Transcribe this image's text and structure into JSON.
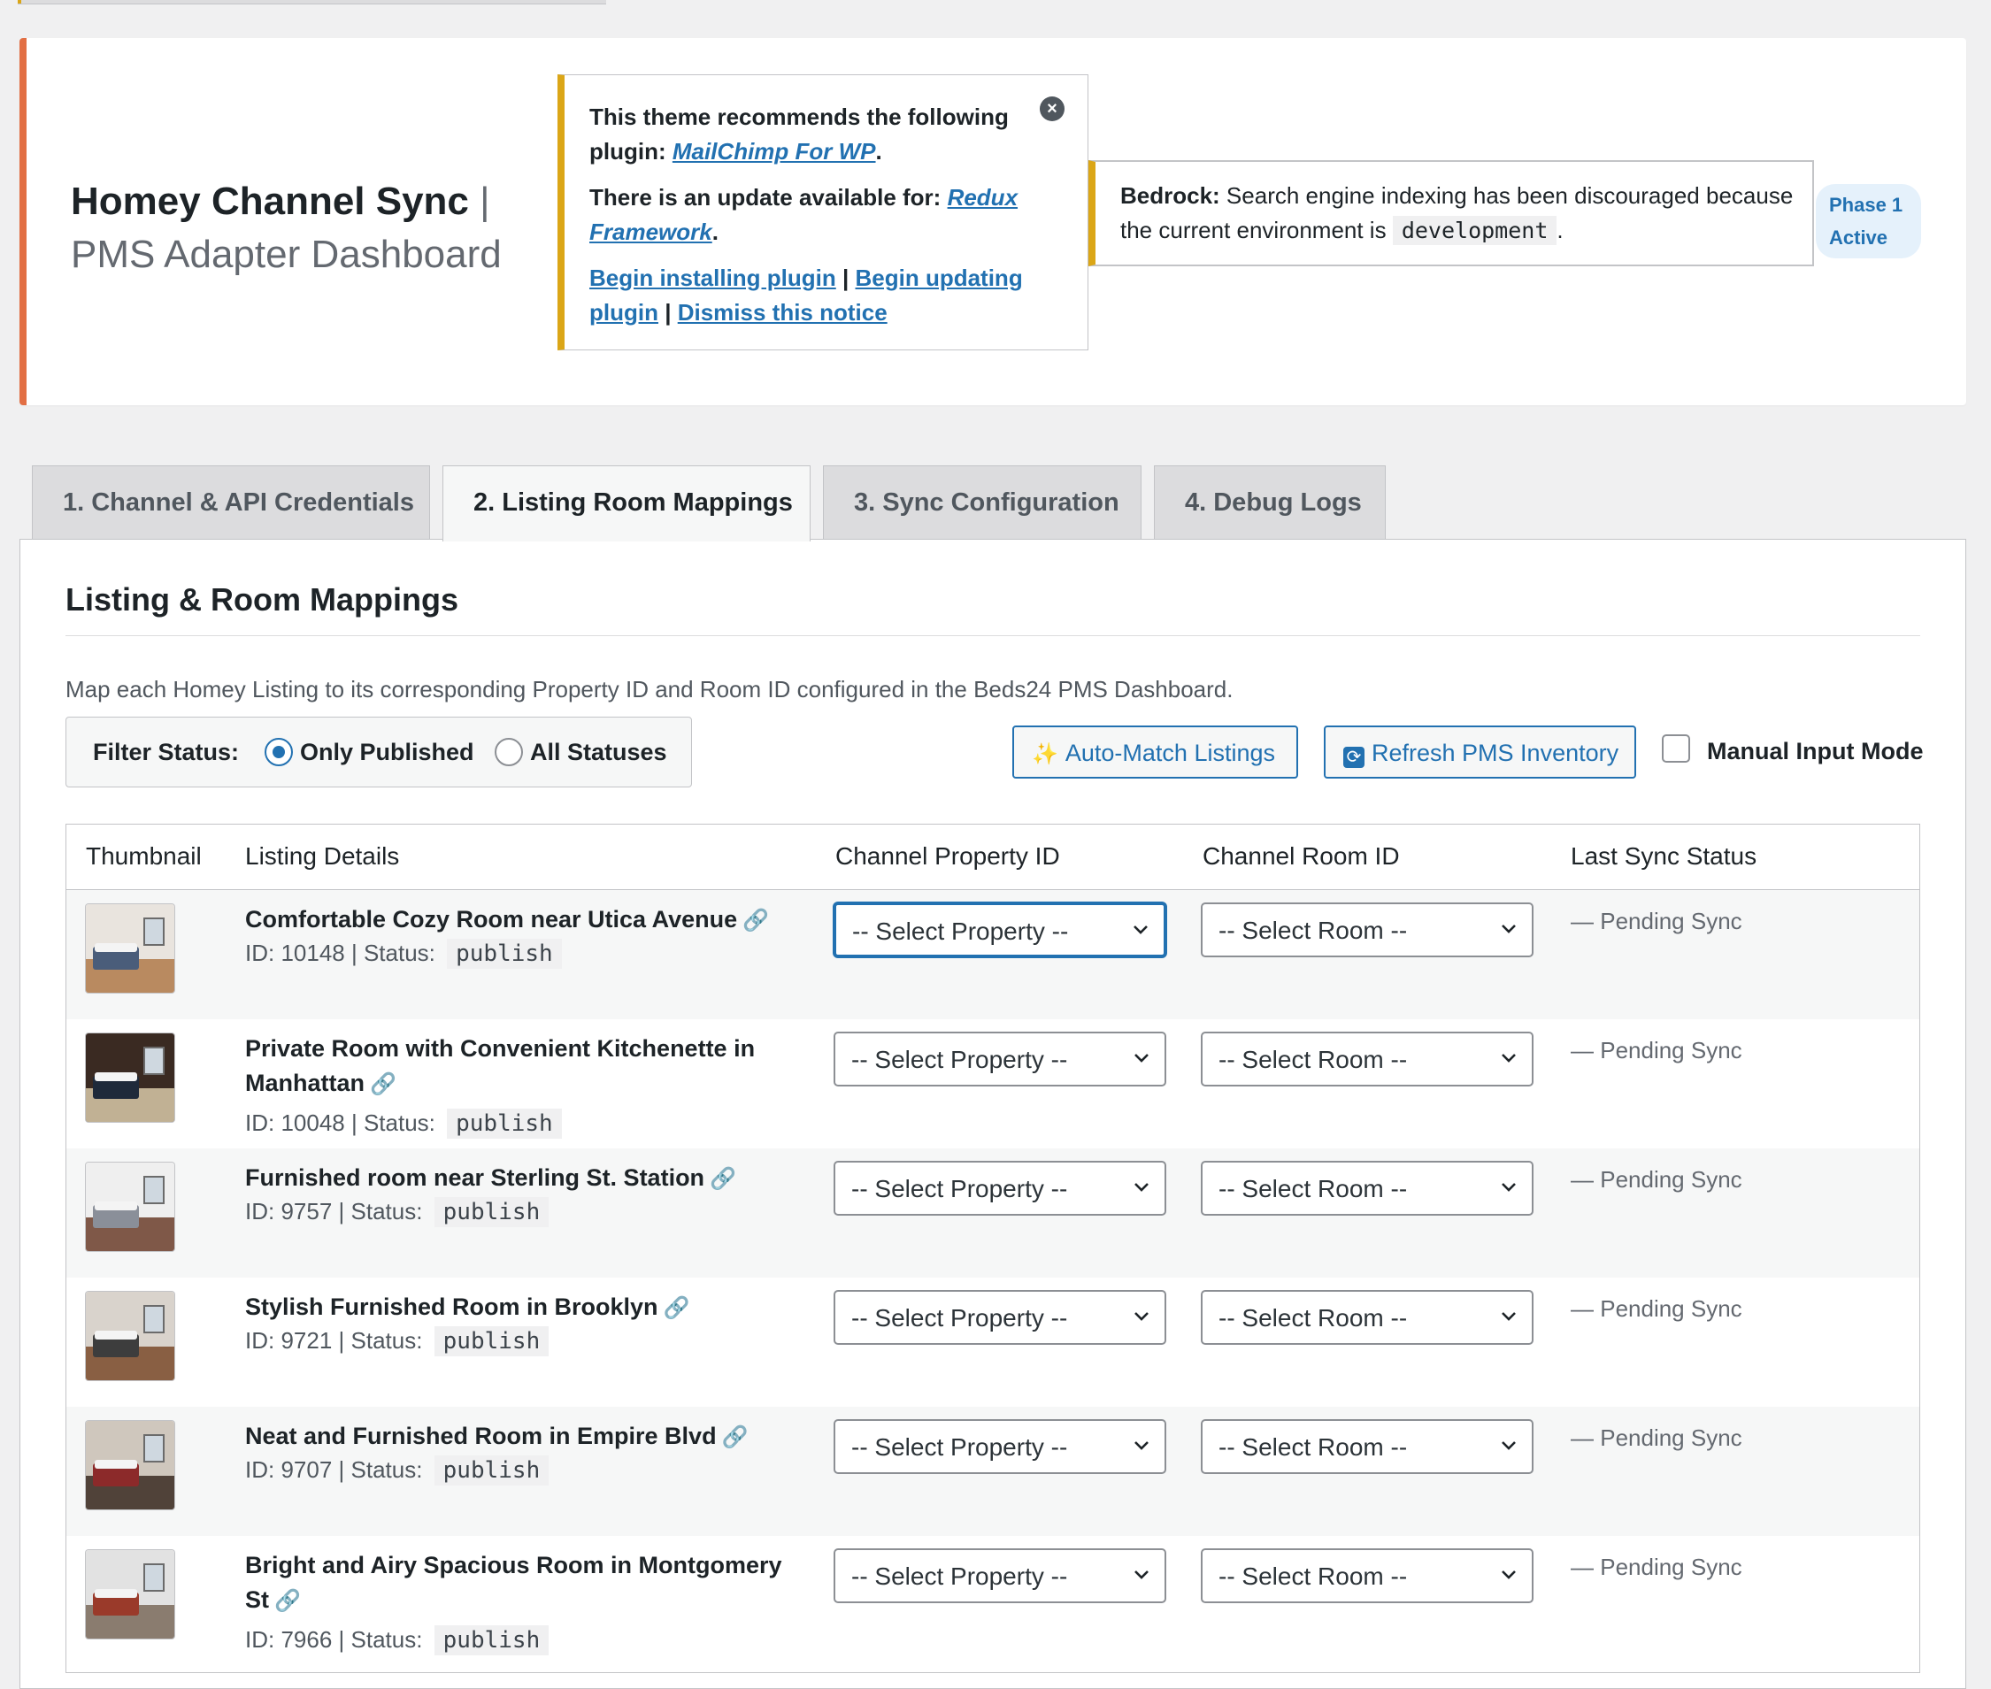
{
  "header": {
    "title": "Homey Channel Sync",
    "separator": "|",
    "subtitle": "PMS Adapter Dashboard",
    "phase_badge_line1": "Phase 1",
    "phase_badge_line2": "Active"
  },
  "plugin_notice": {
    "line1_prefix": "This theme recommends the following plugin: ",
    "line1_link": "MailChimp For WP",
    "line1_suffix": ".",
    "line2_prefix": "There is an update available for: ",
    "line2_link": "Redux Framework",
    "line2_suffix": ".",
    "action_install": "Begin installing plugin",
    "action_update": "Begin updating plugin",
    "action_dismiss": "Dismiss this notice",
    "divider": " | ",
    "close_icon": "×"
  },
  "bedrock_notice": {
    "label": "Bedrock:",
    "text": " Search engine indexing has been discouraged because the current environment is ",
    "env": "development",
    "suffix": "."
  },
  "tabs": [
    {
      "label": "1. Channel & API Credentials",
      "active": false
    },
    {
      "label": "2. Listing Room Mappings",
      "active": true
    },
    {
      "label": "3. Sync Configuration",
      "active": false
    },
    {
      "label": "4. Debug Logs",
      "active": false
    }
  ],
  "panel": {
    "title": "Listing & Room Mappings",
    "description": "Map each Homey Listing to its corresponding Property ID and Room ID configured in the Beds24 PMS Dashboard.",
    "filter_label": "Filter Status:",
    "filter_options": [
      "Only Published",
      "All Statuses"
    ],
    "filter_selected": "Only Published",
    "auto_match_icon": "sparkles-icon",
    "auto_match_label": "Auto-Match Listings",
    "refresh_icon": "refresh-icon",
    "refresh_label": "Refresh PMS Inventory",
    "manual_mode_label": "Manual Input Mode",
    "manual_mode_checked": false
  },
  "table": {
    "columns": [
      "Thumbnail",
      "Listing Details",
      "Channel Property ID",
      "Channel Room ID",
      "Last Sync Status"
    ],
    "id_prefix": "ID: ",
    "status_prefix": " | Status: ",
    "property_placeholder": "-- Select Property --",
    "room_placeholder": "-- Select Room --",
    "link_icon": "link-icon",
    "rows": [
      {
        "title": "Comfortable Cozy Room near Utica Avenue",
        "id": "10148",
        "status": "publish",
        "sync": "— Pending Sync"
      },
      {
        "title": "Private Room with Convenient Kitchenette in Manhattan",
        "id": "10048",
        "status": "publish",
        "sync": "— Pending Sync"
      },
      {
        "title": "Furnished room near Sterling St. Station",
        "id": "9757",
        "status": "publish",
        "sync": "— Pending Sync"
      },
      {
        "title": "Stylish Furnished Room in Brooklyn",
        "id": "9721",
        "status": "publish",
        "sync": "— Pending Sync"
      },
      {
        "title": "Neat and Furnished Room in Empire Blvd",
        "id": "9707",
        "status": "publish",
        "sync": "— Pending Sync"
      },
      {
        "title": "Bright and Airy Spacious Room in Montgomery St",
        "id": "7966",
        "status": "publish",
        "sync": "— Pending Sync"
      }
    ]
  },
  "colors": {
    "accent": "#2271b1",
    "header_border": "#e26f44",
    "notice_border": "#dba617"
  }
}
